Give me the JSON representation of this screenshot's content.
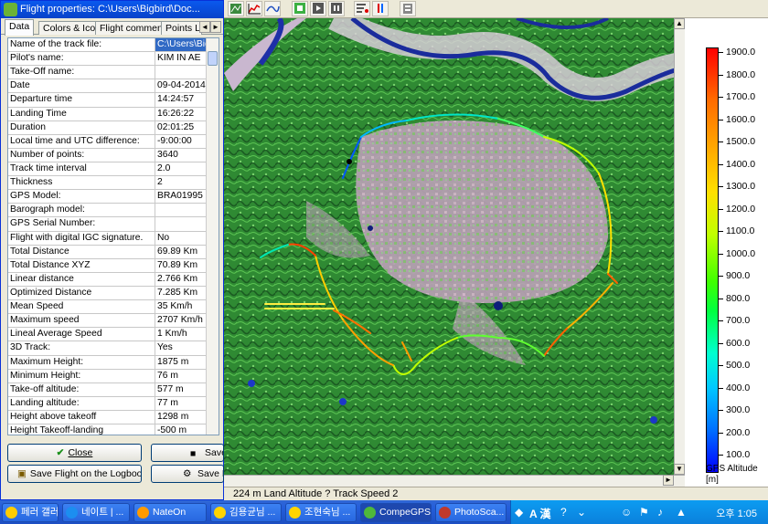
{
  "dialog": {
    "title": "Flight properties: C:\\Users\\Bigbird\\Doc...",
    "tabs": [
      "Data",
      "Colors & Icons",
      "Flight comments",
      "Points Lis"
    ],
    "rows": [
      {
        "label": "Name of the track file:",
        "value": "C:\\Users\\Bigbi"
      },
      {
        "label": "Pilot's name:",
        "value": "KIM IN AE"
      },
      {
        "label": "Take-Off name:",
        "value": ""
      },
      {
        "label": "Date",
        "value": "09-04-2014"
      },
      {
        "label": "Departure time",
        "value": "14:24:57"
      },
      {
        "label": "Landing Time",
        "value": "16:26:22"
      },
      {
        "label": "Duration",
        "value": "02:01:25"
      },
      {
        "label": "Local time and UTC difference:",
        "value": "-9:00:00"
      },
      {
        "label": "Number of points:",
        "value": "3640"
      },
      {
        "label": "Track time interval",
        "value": "2.0"
      },
      {
        "label": "Thickness",
        "value": "2"
      },
      {
        "label": "GPS Model:",
        "value": "BRA01995"
      },
      {
        "label": "Barograph model:",
        "value": ""
      },
      {
        "label": "GPS Serial Number:",
        "value": ""
      },
      {
        "label": "Flight with digital IGC signature.",
        "value": "No"
      },
      {
        "label": "Total Distance",
        "value": "69.89 Km"
      },
      {
        "label": "Total Distance XYZ",
        "value": "70.89 Km"
      },
      {
        "label": "Linear distance",
        "value": "2.766 Km"
      },
      {
        "label": "Optimized Distance",
        "value": "7.285 Km"
      },
      {
        "label": "Mean Speed",
        "value": "35 Km/h"
      },
      {
        "label": "Maximum speed",
        "value": "2707 Km/h"
      },
      {
        "label": "Lineal Average Speed",
        "value": "1 Km/h"
      },
      {
        "label": "3D Track:",
        "value": "Yes"
      },
      {
        "label": "Maximum Height:",
        "value": "1875 m"
      },
      {
        "label": "Minimum Height:",
        "value": "76 m"
      },
      {
        "label": "Take-off altitude:",
        "value": "577 m"
      },
      {
        "label": "Landing altitude:",
        "value": "77 m"
      },
      {
        "label": "Height above takeoff",
        "value": "1298 m"
      },
      {
        "label": "Height Takeoff-landing",
        "value": "-500 m"
      }
    ],
    "buttons": {
      "close": "Close",
      "save": "Save",
      "save_logbook": "Save Flight on the Logbook",
      "save_f": "Save F"
    }
  },
  "status": {
    "text": "224 m Land Altitude ? Track Speed 2"
  },
  "legend": {
    "ticks": [
      "1900.0",
      "1800.0",
      "1700.0",
      "1600.0",
      "1500.0",
      "1400.0",
      "1300.0",
      "1200.0",
      "1100.0",
      "1000.0",
      "900.0",
      "800.0",
      "700.0",
      "600.0",
      "500.0",
      "400.0",
      "300.0",
      "200.0",
      "100.0"
    ],
    "title_line1": "GPS Altitude",
    "title_line2": "[m]"
  },
  "taskbar": {
    "items": [
      {
        "label": "페러 갤러...",
        "color": "#ffcc00"
      },
      {
        "label": "네이트 | ...",
        "color": "#1c8ef0"
      },
      {
        "label": "NateOn",
        "color": "#ff9a00"
      },
      {
        "label": "김용균님 ...",
        "color": "#ffd400"
      },
      {
        "label": "조현숙님 ...",
        "color": "#ffd400"
      },
      {
        "label": "CompeGPS",
        "color": "#4fb83a"
      },
      {
        "label": "PhotoSca...",
        "color": "#c0392b"
      }
    ],
    "ime": "A 漢",
    "clock": "오후 1:05"
  }
}
